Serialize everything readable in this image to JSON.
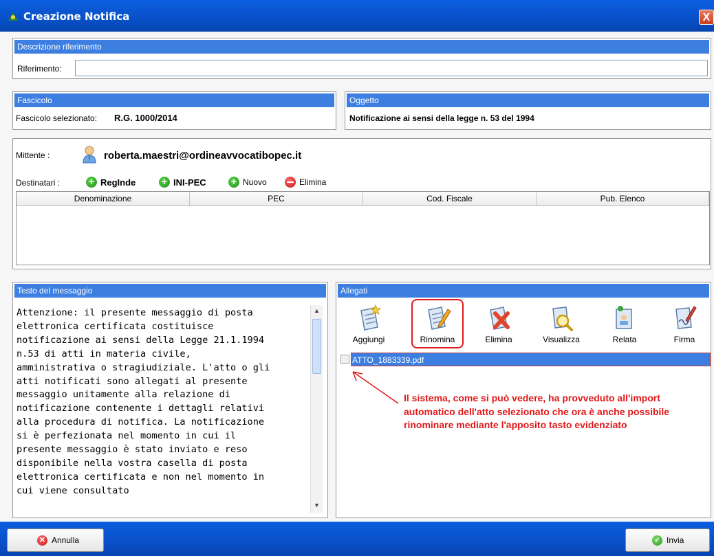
{
  "window": {
    "title": "Creazione Notifica",
    "close_label": "X"
  },
  "riferimento": {
    "header": "Descrizione riferimento",
    "label": "Riferimento:",
    "value": ""
  },
  "fascicolo": {
    "header": "Fascicolo",
    "label": "Fascicolo selezionato:",
    "value": "R.G. 1000/2014"
  },
  "oggetto": {
    "header": "Oggetto",
    "value": "Notificazione ai sensi della legge n. 53 del 1994"
  },
  "mittente": {
    "label": "Mittente :",
    "email": "roberta.maestri@ordineavvocatibopec.it"
  },
  "destinatari": {
    "label": "Destinatari :",
    "buttons": [
      "RegInde",
      "INI-PEC",
      "Nuovo",
      "Elimina"
    ],
    "columns": [
      "Denominazione",
      "PEC",
      "Cod. Fiscale",
      "Pub. Elenco"
    ]
  },
  "messaggio": {
    "header": "Testo del messaggio",
    "text": "Attenzione: il presente messaggio di posta\nelettronica certificata costituisce\nnotificazione ai sensi della Legge 21.1.1994\nn.53 di atti in materia civile,\namministrativa o stragiudiziale. L'atto o gli\natti notificati sono allegati al presente\nmessaggio unitamente alla relazione di\nnotificazione contenente i dettagli relativi\nalla procedura di notifica. La notificazione\nsi è perfezionata nel momento in cui il\npresente messaggio è stato inviato e reso\ndisponibile nella vostra casella di posta\nelettronica certificata e non nel momento in\ncui viene consultato"
  },
  "allegati": {
    "header": "Allegati",
    "tools": [
      {
        "label": "Aggiungi",
        "icon": "add-document-icon"
      },
      {
        "label": "Rinomina",
        "icon": "rename-document-icon"
      },
      {
        "label": "Elimina",
        "icon": "delete-document-icon"
      },
      {
        "label": "Visualizza",
        "icon": "view-document-icon"
      },
      {
        "label": "Relata",
        "icon": "relata-document-icon"
      },
      {
        "label": "Firma",
        "icon": "sign-document-icon"
      }
    ],
    "files": [
      {
        "name": "ATTO_1883339.pdf",
        "checked": false
      }
    ]
  },
  "annotation": "Il sistema, come si può vedere, ha provveduto all'import automatico dell'atto selezionato che ora è anche possibile rinominare mediante l'apposito tasto evidenziato",
  "footer": {
    "cancel_label": "Annulla",
    "send_label": "Invia"
  },
  "colors": {
    "titlebar": "#0950c8",
    "panel_header": "#3d7fe0",
    "annotation": "#e01818",
    "selection": "#3d7fe0"
  }
}
